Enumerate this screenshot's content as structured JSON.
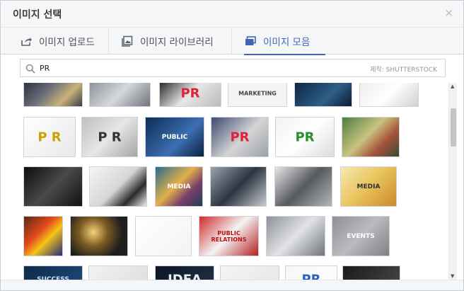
{
  "dialog": {
    "title": "이미지 선택",
    "close_symbol": "×"
  },
  "tabs": [
    {
      "label": "이미지 업로드",
      "icon": "upload-icon",
      "active": false
    },
    {
      "label": "이미지 라이브러리",
      "icon": "image-library-icon",
      "active": false
    },
    {
      "label": "이미지 모음",
      "icon": "image-collection-icon",
      "active": true
    }
  ],
  "search": {
    "value": "PR",
    "credit": "제작: SHUTTERSTOCK"
  },
  "colors": {
    "accent": "#4267b2",
    "header_bg": "#f5f6f7",
    "border": "#d3d6db"
  },
  "thumbnails": [
    {
      "name": "thumb-microphones-press",
      "text": "",
      "bg": "linear-gradient(135deg,#2a2e3a,#6b6f7a 40%,#c9b27a 70%,#3a3d48)",
      "fg": "#fff"
    },
    {
      "name": "thumb-pr-scene",
      "text": "",
      "bg": "linear-gradient(135deg,#8a8f96,#d5d8dc 50%,#6f747b)",
      "fg": "#fff"
    },
    {
      "name": "thumb-pr-newspaper",
      "text": "PR",
      "bg": "linear-gradient(135deg,#222,#e7e7e7 50%,#b9b9b9)",
      "fg": "#e0213a"
    },
    {
      "name": "thumb-marketing-hand",
      "text": "MARKETING",
      "bg": "#f4f4f4",
      "fg": "#444"
    },
    {
      "name": "thumb-business-touch",
      "text": "",
      "bg": "linear-gradient(135deg,#0b2540,#2e5e88 60%,#0c1d33)",
      "fg": "#fff"
    },
    {
      "name": "thumb-words-cloud",
      "text": "",
      "bg": "linear-gradient(135deg,#ececec,#ffffff 50%,#d0d0d0)",
      "fg": "#333"
    },
    {
      "name": "thumb-pr-dice",
      "text": "P R",
      "bg": "linear-gradient(135deg,#ffffff,#e8e8e8)",
      "fg": "#c9a400"
    },
    {
      "name": "thumb-pr-blocks",
      "text": "P R",
      "bg": "linear-gradient(135deg,#bfbfbf,#e6e6e6 50%,#a4a4a4)",
      "fg": "#333"
    },
    {
      "name": "thumb-public-relations-network",
      "text": "PUBLIC",
      "bg": "linear-gradient(135deg,#0c2c55,#3d6fb3 60%,#0a1f3c)",
      "fg": "#fff"
    },
    {
      "name": "thumb-pr-letters-newspaper",
      "text": "PR",
      "bg": "linear-gradient(135deg,#3a4a70,#d5d5d5 55%,#9aa0a8)",
      "fg": "#e0213a"
    },
    {
      "name": "thumb-pr-keyboard",
      "text": "PR",
      "bg": "linear-gradient(135deg,#f2f2f2,#ffffff 50%,#dcdcdc)",
      "fg": "#2a8f2a"
    },
    {
      "name": "thumb-newspapers-hand",
      "text": "",
      "bg": "linear-gradient(135deg,#4f7d44,#c8c47e 45%,#a6533d 70%,#3a4b2e)",
      "fg": "#fff"
    },
    {
      "name": "thumb-mics-dark",
      "text": "",
      "bg": "linear-gradient(135deg,#0d0d0d,#4a4a4a 50%,#111)",
      "fg": "#fff"
    },
    {
      "name": "thumb-interview",
      "text": "",
      "bg": "linear-gradient(135deg,#f5f5f5,#d6d6d6 50%,#2b2b2b 75%,#f1f1f1)",
      "fg": "#fff"
    },
    {
      "name": "thumb-media-laptop",
      "text": "MEDIA",
      "bg": "linear-gradient(135deg,#2a6b8a,#e2b14a 45%,#7a3f6a 70%,#1f3d55)",
      "fg": "#fff"
    },
    {
      "name": "thumb-crowd-mics",
      "text": "",
      "bg": "linear-gradient(135deg,#9aa3ad,#2c3440 50%,#c8ccd2)",
      "fg": "#fff"
    },
    {
      "name": "thumb-press-conference",
      "text": "",
      "bg": "linear-gradient(135deg,#e6e6e6,#56595e 50%,#b3b6bb)",
      "fg": "#fff"
    },
    {
      "name": "thumb-the-media",
      "text": "MEDIA",
      "bg": "linear-gradient(135deg,#f7e9b0,#e8c25a 50%,#c98a2a)",
      "fg": "#333"
    },
    {
      "name": "thumb-colorful-pr",
      "text": "",
      "bg": "linear-gradient(135deg,#5a2a12,#e44a1f 40%,#f2c419 60%,#2a2a7a)",
      "fg": "#fff"
    },
    {
      "name": "thumb-lightbulb",
      "text": "",
      "bg": "radial-gradient(circle at 40% 40%,#f6d27a,#7a5a22 35%,#1f1f1f 70%)",
      "fg": "#fff"
    },
    {
      "name": "thumb-megaphone-hand",
      "text": "",
      "bg": "linear-gradient(135deg,#ffffff,#f3f3f3)",
      "fg": "#d22"
    },
    {
      "name": "thumb-public-relations-sign",
      "text": "PUBLIC RELATIONS",
      "bg": "linear-gradient(135deg,#d12a2a,#f4f4f4 50%,#b51d1d)",
      "fg": "#b11"
    },
    {
      "name": "thumb-reporter-badge",
      "text": "",
      "bg": "linear-gradient(135deg,#8d9096,#e1e3e6 50%,#6f7378)",
      "fg": "#fff"
    },
    {
      "name": "thumb-events-letters",
      "text": "EVENTS",
      "bg": "linear-gradient(135deg,#8e9094,#b9bbbf 50%,#7e8085)",
      "fg": "#fff"
    },
    {
      "name": "thumb-success-board",
      "text": "SUCCESS",
      "bg": "linear-gradient(135deg,#0f2a48,#1d4d7d)",
      "fg": "#cfe3ff"
    },
    {
      "name": "thumb-blurred-office",
      "text": "",
      "bg": "linear-gradient(135deg,#f2f2f2,#dcdcdc)",
      "fg": "#fff"
    },
    {
      "name": "thumb-idea-chalkboard",
      "text": "IDEA",
      "bg": "linear-gradient(135deg,#0b1624,#223347)",
      "fg": "#e9eef5"
    },
    {
      "name": "thumb-laptop-screen",
      "text": "",
      "bg": "linear-gradient(135deg,#f4f4f4,#e6e6e6)",
      "fg": "#fff"
    },
    {
      "name": "thumb-pr-blue",
      "text": "PR",
      "bg": "linear-gradient(135deg,#f6f6f6,#ffffff)",
      "fg": "#2d62c0"
    },
    {
      "name": "thumb-text-collage",
      "text": "",
      "bg": "linear-gradient(135deg,#1a1a1a,#4a4a4a)",
      "fg": "#fff"
    }
  ]
}
